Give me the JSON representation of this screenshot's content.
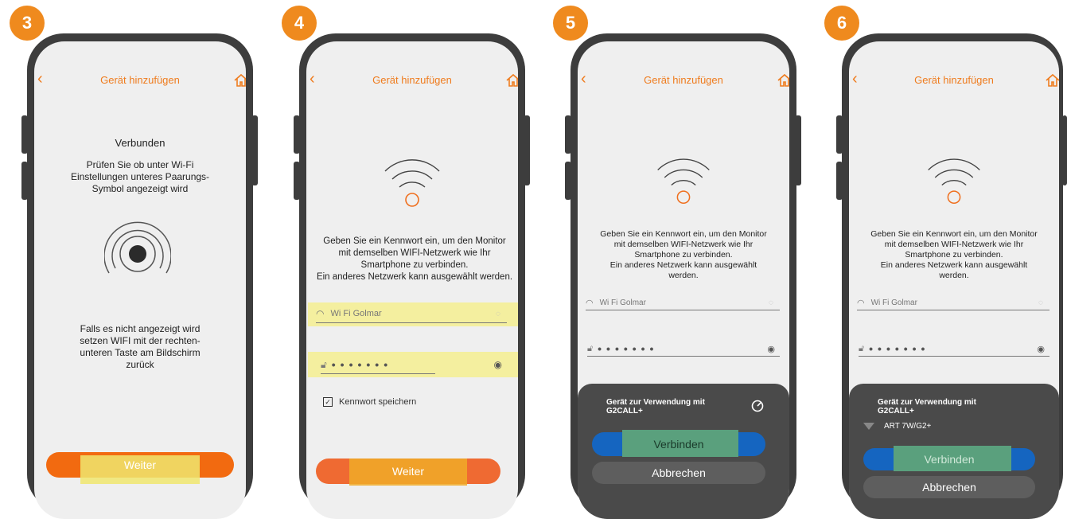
{
  "steps": [
    {
      "number": "3",
      "title": "Gerät hinzufügen",
      "status": "Verbunden",
      "instruction": [
        "Prüfen Sie ob unter Wi-Fi",
        "Einstellungen unteres Paarungs-",
        "Symbol angezeigt wird"
      ],
      "fallback": [
        "Falls es nicht angezeigt wird",
        "setzen WIFI mit der rechten-",
        "unteren Taste am Bildschirm",
        "zurück"
      ],
      "button": "Weiter"
    },
    {
      "number": "4",
      "title": "Gerät hinzufügen",
      "prompt": [
        "Geben Sie ein Kennwort ein, um den Monitor",
        "mit demselben WIFI-Netzwerk wie Ihr",
        "Smartphone zu verbinden.",
        "Ein anderes Netzwerk kann ausgewählt werden."
      ],
      "wifi_name": "Wi Fi Golmar",
      "password_mask": "•••••••",
      "save_label": "Kennwort speichern",
      "button": "Weiter"
    },
    {
      "number": "5",
      "title": "Gerät hinzufügen",
      "prompt": [
        "Geben Sie ein Kennwort ein, um den Monitor",
        "mit demselben WIFI-Netzwerk wie Ihr",
        "Smartphone zu verbinden.",
        "Ein anderes Netzwerk kann ausgewählt",
        "werden."
      ],
      "wifi_name": "Wi Fi Golmar",
      "password_mask": "•••••••",
      "sheet_title": [
        "Gerät zur Verwendung mit",
        "G2CALL+"
      ],
      "connect": "Verbinden",
      "cancel": "Abbrechen"
    },
    {
      "number": "6",
      "title": "Gerät hinzufügen",
      "prompt": [
        "Geben Sie ein Kennwort ein, um den Monitor",
        "mit demselben WIFI-Netzwerk wie Ihr",
        "Smartphone zu verbinden.",
        "Ein anderes Netzwerk kann ausgewählt",
        "werden."
      ],
      "wifi_name": "Wi Fi Golmar",
      "password_mask": "•••••••",
      "sheet_title": [
        "Gerät zur Verwendung mit",
        "G2CALL+"
      ],
      "device": "ART 7W/G2+",
      "connect": "Verbinden",
      "cancel": "Abbrechen"
    }
  ],
  "colors": {
    "accent": "#ef7c1e",
    "badge": "#ef8a1e",
    "frame": "#3d3d3d",
    "screen": "#efefef",
    "sheet": "#4a4a4a",
    "blue": "#1565c0"
  },
  "icons": [
    "chevron-left-icon",
    "home-icon",
    "wifi-icon",
    "pairing-icon",
    "lock-icon",
    "eye-icon",
    "checkbox-icon",
    "spinner-icon"
  ]
}
